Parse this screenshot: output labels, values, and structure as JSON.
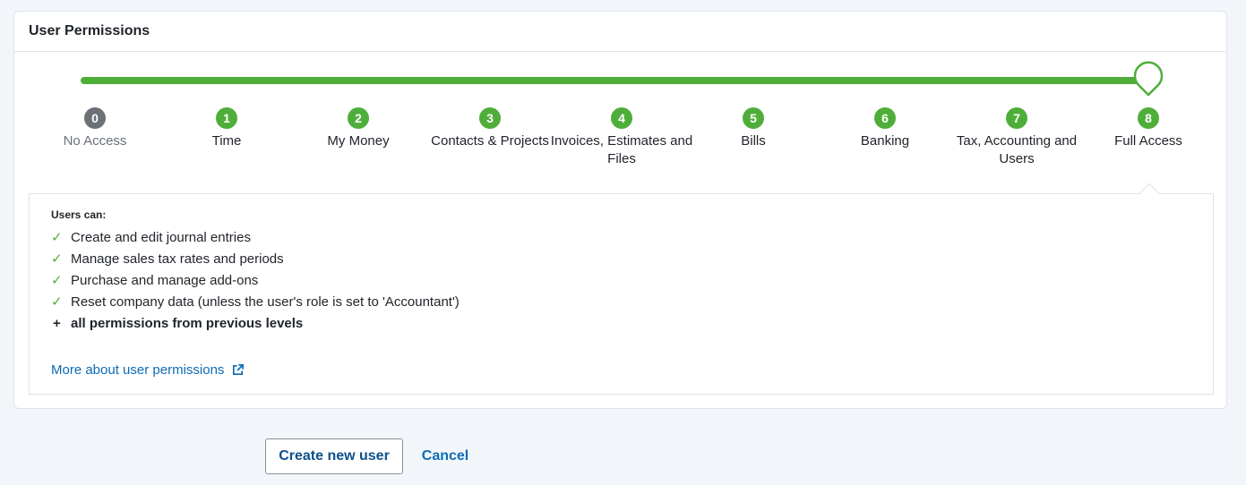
{
  "panel": {
    "title": "User Permissions"
  },
  "slider": {
    "selected_level": 8,
    "max_level": 8,
    "active_color": "#4fae3a",
    "inactive_color": "#6b7177",
    "steps": [
      {
        "number": "0",
        "label": "No Access"
      },
      {
        "number": "1",
        "label": "Time"
      },
      {
        "number": "2",
        "label": "My Money"
      },
      {
        "number": "3",
        "label": "Contacts & Projects"
      },
      {
        "number": "4",
        "label": "Invoices, Estimates and Files"
      },
      {
        "number": "5",
        "label": "Bills"
      },
      {
        "number": "6",
        "label": "Banking"
      },
      {
        "number": "7",
        "label": "Tax, Accounting and Users"
      },
      {
        "number": "8",
        "label": "Full Access"
      }
    ]
  },
  "details": {
    "heading": "Users can:",
    "permissions": [
      "Create and edit journal entries",
      "Manage sales tax rates and periods",
      "Purchase and manage add-ons",
      "Reset company data (unless the user's role is set to 'Accountant')"
    ],
    "previous_note": "all permissions from previous levels",
    "more_link": "More about user permissions",
    "more_link_icon": "external-link-icon"
  },
  "actions": {
    "create_label": "Create new user",
    "cancel_label": "Cancel"
  }
}
